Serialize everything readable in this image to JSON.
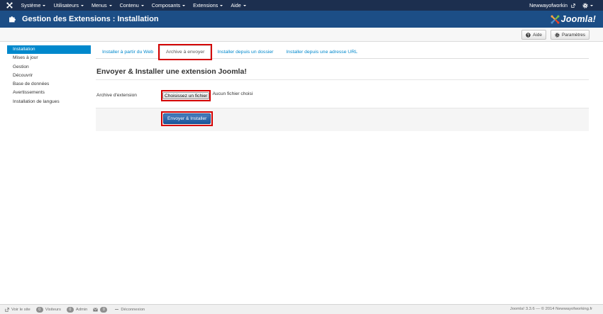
{
  "colors": {
    "topbar_bg": "#1c2f4f",
    "header_bg": "#1c4e86",
    "accent": "#0088cc",
    "primary_button": "#1f62b0",
    "highlight_border": "#d40000"
  },
  "topbar": {
    "menus": [
      {
        "label": "Système"
      },
      {
        "label": "Utilisateurs"
      },
      {
        "label": "Menus"
      },
      {
        "label": "Contenu"
      },
      {
        "label": "Composants"
      },
      {
        "label": "Extensions"
      },
      {
        "label": "Aide"
      }
    ],
    "user_label": "Newwayofworkin"
  },
  "header": {
    "title": "Gestion des Extensions : Installation",
    "brand_text": "Joomla!"
  },
  "toolbar": {
    "help_label": "Aide",
    "options_label": "Paramètres"
  },
  "sidebar": {
    "items": [
      {
        "label": "Installation",
        "active": true
      },
      {
        "label": "Mises à jour",
        "active": false
      },
      {
        "label": "Gestion",
        "active": false
      },
      {
        "label": "Découvrir",
        "active": false
      },
      {
        "label": "Base de données",
        "active": false
      },
      {
        "label": "Avertissements",
        "active": false
      },
      {
        "label": "Installation de langues",
        "active": false
      }
    ]
  },
  "tabs": [
    {
      "label": "Installer à partir du Web",
      "active": false
    },
    {
      "label": "Archive à envoyer",
      "active": true
    },
    {
      "label": "Installer depuis un dossier",
      "active": false
    },
    {
      "label": "Installer depuis une adresse URL",
      "active": false
    }
  ],
  "main": {
    "heading": "Envoyer & Installer une extension Joomla!",
    "field_label": "Archive d'extension",
    "file_button_label": "Choisissez un fichier",
    "file_status": "Aucun fichier choisi",
    "submit_label": "Envoyer & Installer"
  },
  "footer": {
    "view_site_label": "Voir le site",
    "visitors_count": "0",
    "visitors_label": "Visiteurs",
    "admins_count": "0",
    "admins_label": "Admin",
    "messages_count": "0",
    "logout_label": "Déconnexion",
    "copyright": "Joomla! 3.3.6 — © 2014 Newwayofworking.fr"
  }
}
